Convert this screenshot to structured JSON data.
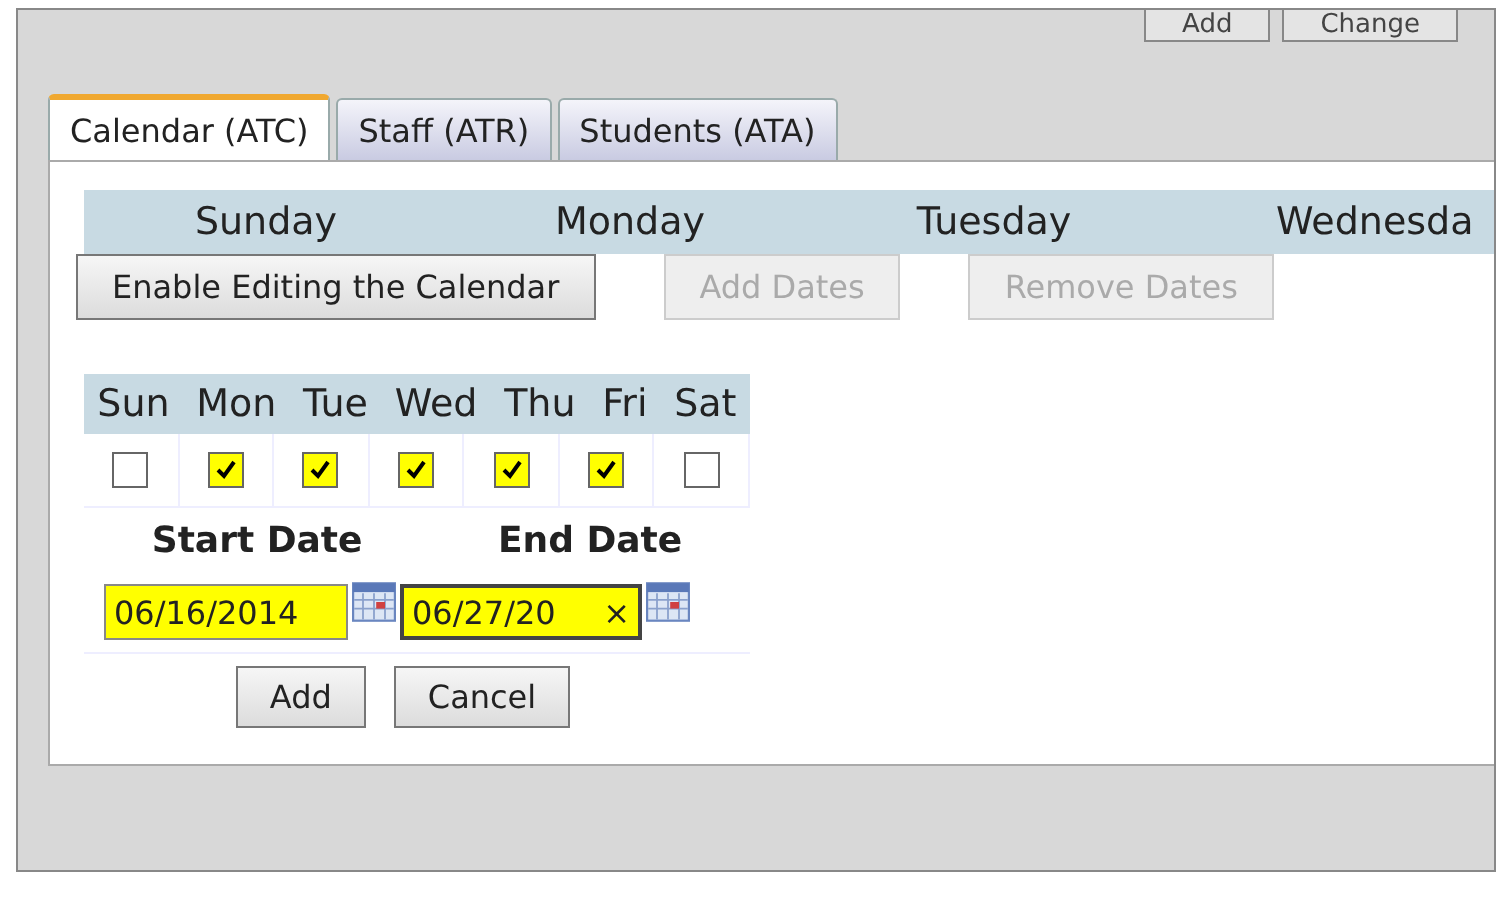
{
  "top_buttons": [
    {
      "label": "Add"
    },
    {
      "label": "Change"
    }
  ],
  "tabs": [
    {
      "label": "Calendar (ATC)",
      "selected": true
    },
    {
      "label": "Staff (ATR)",
      "selected": false
    },
    {
      "label": "Students (ATA)",
      "selected": false
    }
  ],
  "week_header": [
    "Sunday",
    "Monday",
    "Tuesday",
    "Wednesda"
  ],
  "toolbar": [
    {
      "label": "Enable Editing the Calendar",
      "disabled": false
    },
    {
      "label": "Add Dates",
      "disabled": true
    },
    {
      "label": "Remove Dates",
      "disabled": true
    }
  ],
  "day_picker": {
    "days": [
      {
        "label": "Sun",
        "checked": false
      },
      {
        "label": "Mon",
        "checked": true
      },
      {
        "label": "Tue",
        "checked": true
      },
      {
        "label": "Wed",
        "checked": true
      },
      {
        "label": "Thu",
        "checked": true
      },
      {
        "label": "Fri",
        "checked": true
      },
      {
        "label": "Sat",
        "checked": false
      }
    ],
    "start_date": {
      "label": "Start Date",
      "value": "06/16/2014"
    },
    "end_date": {
      "label": "End Date",
      "value": "06/27/20",
      "clear": "×"
    },
    "buttons": [
      "Add",
      "Cancel"
    ]
  }
}
